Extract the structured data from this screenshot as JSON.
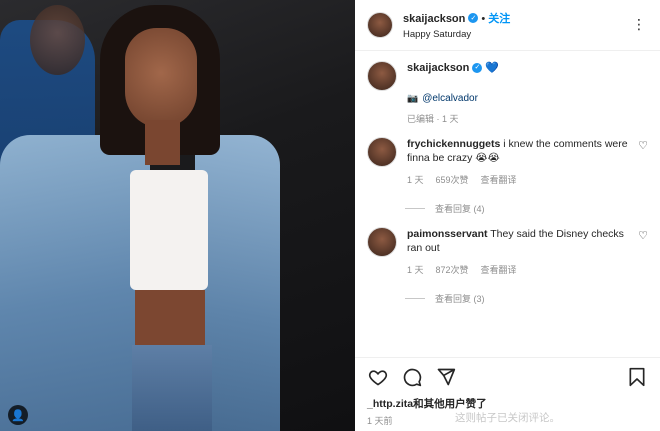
{
  "post": {
    "username": "skaijackson",
    "follow_label": "关注",
    "location": "Happy Saturday",
    "caption": {
      "username": "skaijackson",
      "mention": "@elcalvador",
      "meta": "已编辑 · 1 天"
    }
  },
  "comments": [
    {
      "username": "frychickennuggets",
      "text": "i knew the comments were finna be crazy 😭😭",
      "time": "1 天",
      "likes": "659次赞",
      "translate": "查看翻译",
      "replies": "查看回复 (4)"
    },
    {
      "username": "paimonsservant",
      "text": "They said the Disney checks ran out",
      "time": "1 天",
      "likes": "872次赞",
      "translate": "查看翻译",
      "replies": "查看回复 (3)"
    }
  ],
  "actions": {
    "likes_line": "_http.zita和其他用户赞了",
    "time": "1 天前",
    "add_comment_placeholder": "这则帖子已关闭评论。"
  },
  "colors": {
    "accent": "#0095f6",
    "verified": "#1c96f0"
  }
}
